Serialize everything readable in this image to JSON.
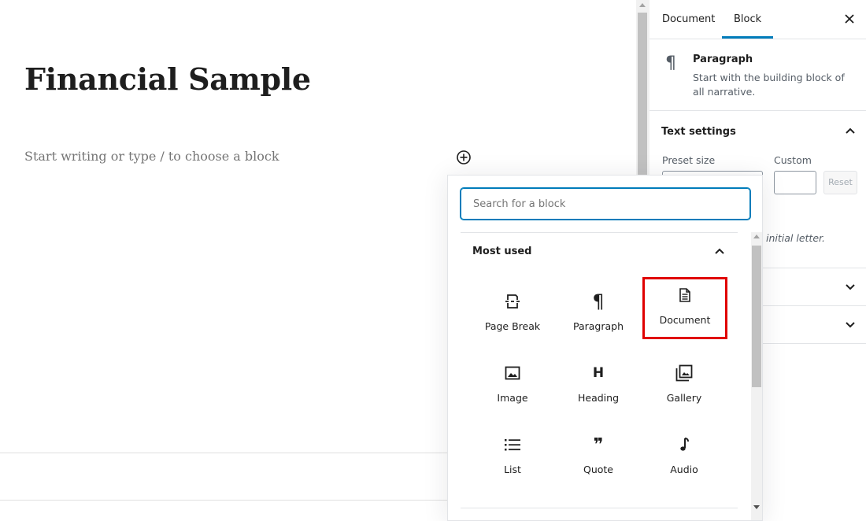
{
  "editor": {
    "post_title": "Financial Sample",
    "placeholder": "Start writing or type / to choose a block"
  },
  "sidebar": {
    "tabs": [
      {
        "label": "Document"
      },
      {
        "label": "Block",
        "active": true
      }
    ],
    "block_card": {
      "icon": "paragraph-icon",
      "name": "Paragraph",
      "description": "Start with the building block of all narrative."
    },
    "text_settings": {
      "title": "Text settings",
      "preset_label": "Preset size",
      "custom_label": "Custom",
      "reset_label": "Reset",
      "drop_cap_hint": "initial letter."
    }
  },
  "inserter": {
    "search_placeholder": "Search for a block",
    "category": "Most used",
    "blocks": [
      {
        "label": "Page Break",
        "icon": "page-break-icon"
      },
      {
        "label": "Paragraph",
        "icon": "paragraph-icon"
      },
      {
        "label": "Document",
        "icon": "document-icon",
        "highlighted": true
      },
      {
        "label": "Image",
        "icon": "image-icon"
      },
      {
        "label": "Heading",
        "icon": "heading-icon"
      },
      {
        "label": "Gallery",
        "icon": "gallery-icon"
      },
      {
        "label": "List",
        "icon": "list-icon"
      },
      {
        "label": "Quote",
        "icon": "quote-icon"
      },
      {
        "label": "Audio",
        "icon": "audio-icon"
      }
    ]
  },
  "colors": {
    "accent": "#007cba",
    "highlight": "#e00000"
  }
}
